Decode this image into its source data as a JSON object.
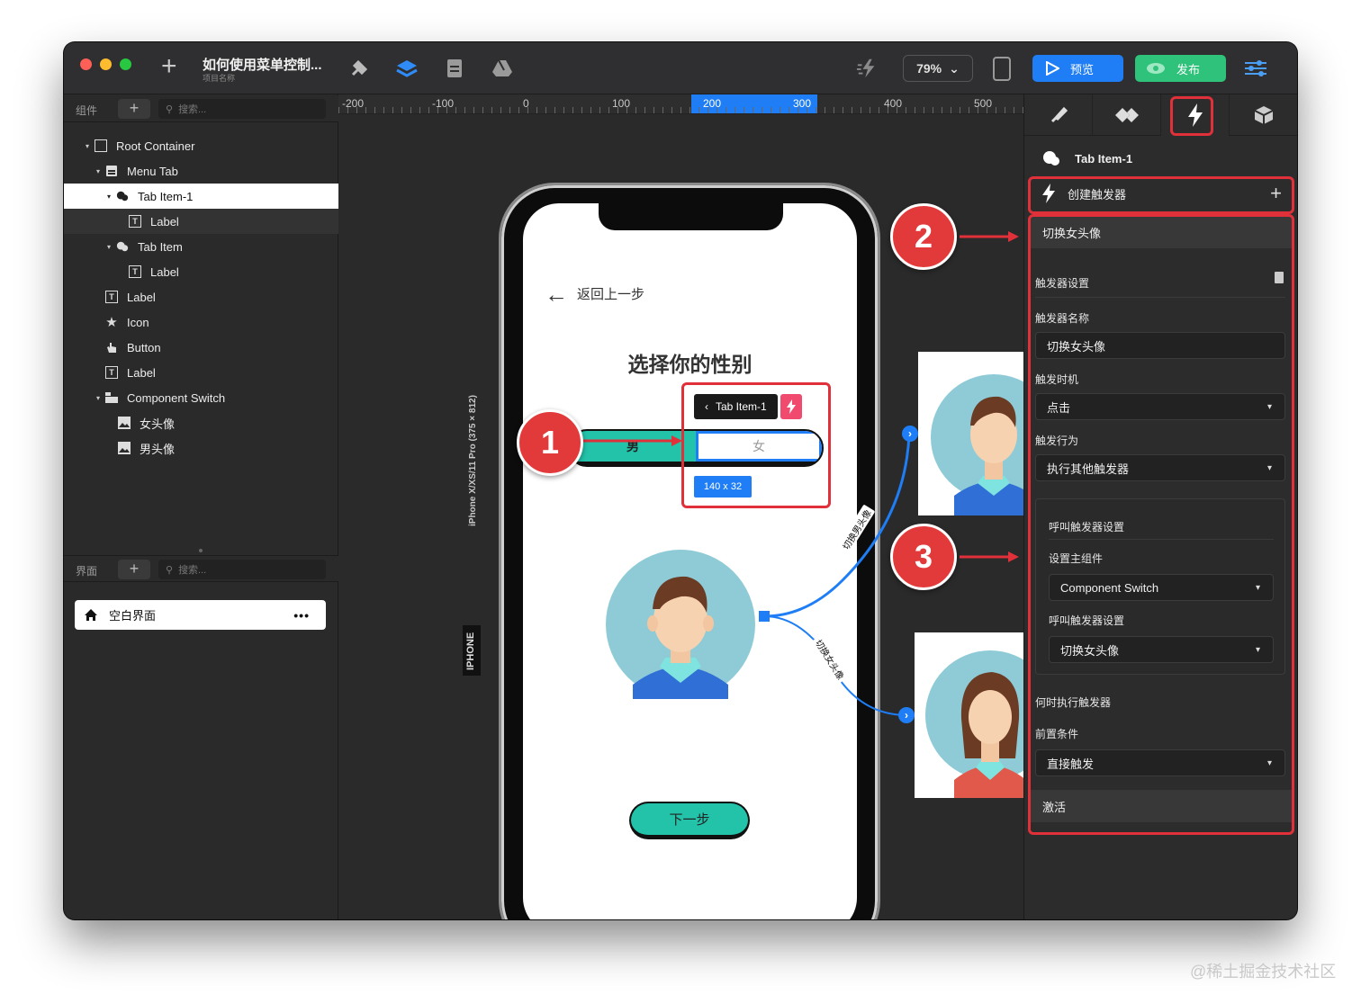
{
  "titlebar": {
    "project_title": "如何使用菜单控制...",
    "project_subtitle": "项目名称",
    "zoom": "79%",
    "preview_label": "预览",
    "publish_label": "发布"
  },
  "components_panel": {
    "header_label": "组件",
    "search_placeholder": "搜索...",
    "tree": [
      {
        "label": "Root Container",
        "icon": "square-icon"
      },
      {
        "label": "Menu Tab",
        "icon": "menu-tab-icon"
      },
      {
        "label": "Tab Item-1",
        "icon": "tab-item-icon"
      },
      {
        "label": "Label",
        "icon": "text-icon"
      },
      {
        "label": "Tab Item",
        "icon": "tab-item-icon"
      },
      {
        "label": "Label",
        "icon": "text-icon"
      },
      {
        "label": "Label",
        "icon": "text-icon"
      },
      {
        "label": "Icon",
        "icon": "star-icon"
      },
      {
        "label": "Button",
        "icon": "hand-icon"
      },
      {
        "label": "Label",
        "icon": "text-icon"
      },
      {
        "label": "Component Switch",
        "icon": "component-switch-icon"
      },
      {
        "label": "女头像",
        "icon": "image-icon"
      },
      {
        "label": "男头像",
        "icon": "image-icon"
      }
    ]
  },
  "pages_panel": {
    "header_label": "界面",
    "search_placeholder": "搜索...",
    "page_name": "空白界面"
  },
  "ruler": {
    "labels": [
      "-200",
      "-100",
      "0",
      "100",
      "200",
      "300",
      "400",
      "500"
    ]
  },
  "device": {
    "label": "iPhone X/XS/11 Pro (375 × 812)",
    "chip": "IPHONE"
  },
  "screen": {
    "back_label": "返回上一步",
    "title": "选择你的性别",
    "tab_male": "男",
    "tab_female": "女",
    "selected_tag": "Tab Item-1",
    "size_tag": "140 x 32",
    "next_button": "下一步"
  },
  "connectors": {
    "to_male": "切换男头像",
    "to_female": "切换女头像"
  },
  "badges": [
    "1",
    "2",
    "3"
  ],
  "inspector": {
    "component_name": "Tab Item-1",
    "create_trigger": "创建触发器",
    "trigger_header": "切换女头像",
    "trigger_settings": "触发器设置",
    "trigger_name_label": "触发器名称",
    "trigger_name_value": "切换女头像",
    "trigger_timing_label": "触发时机",
    "trigger_timing_value": "点击",
    "trigger_action_label": "触发行为",
    "trigger_action_value": "执行其他触发器",
    "call_settings_label": "呼叫触发器设置",
    "main_component_label": "设置主组件",
    "main_component_value": "Component Switch",
    "call_trigger_label": "呼叫触发器设置",
    "call_trigger_value": "切换女头像",
    "when_label": "何时执行触发器",
    "precondition_label": "前置条件",
    "precondition_value": "直接触发",
    "activate_label": "激活"
  },
  "colors": {
    "accent_blue": "#1f7ef5",
    "publish_green": "#2ec27a",
    "teal": "#22c3a9",
    "annotation_red": "#e0303a"
  },
  "watermark": "@稀土掘金技术社区"
}
